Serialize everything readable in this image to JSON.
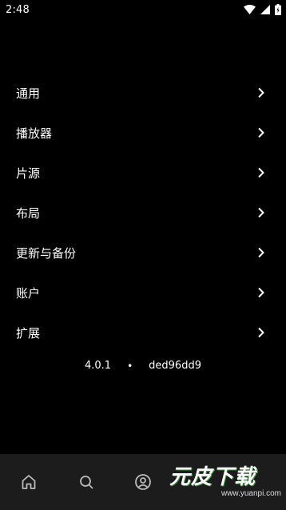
{
  "status_bar": {
    "time": "2:48",
    "icons": [
      "wifi-icon",
      "signal-icon",
      "battery-icon"
    ]
  },
  "menu": {
    "items": [
      {
        "label": "通用"
      },
      {
        "label": "播放器"
      },
      {
        "label": "片源"
      },
      {
        "label": "布局"
      },
      {
        "label": "更新与备份"
      },
      {
        "label": "账户"
      },
      {
        "label": "扩展"
      }
    ]
  },
  "version": {
    "number": "4.0.1",
    "separator": "•",
    "commit": "ded96dd9"
  },
  "bottom_nav": {
    "items": [
      "home-icon",
      "search-icon",
      "account-icon"
    ]
  },
  "watermark": {
    "logo_text": "元皮下载",
    "url": "www.yuanpi.com"
  },
  "colors": {
    "background": "#000000",
    "bottom_nav_background": "#1c1c1c",
    "text": "#ffffff"
  }
}
